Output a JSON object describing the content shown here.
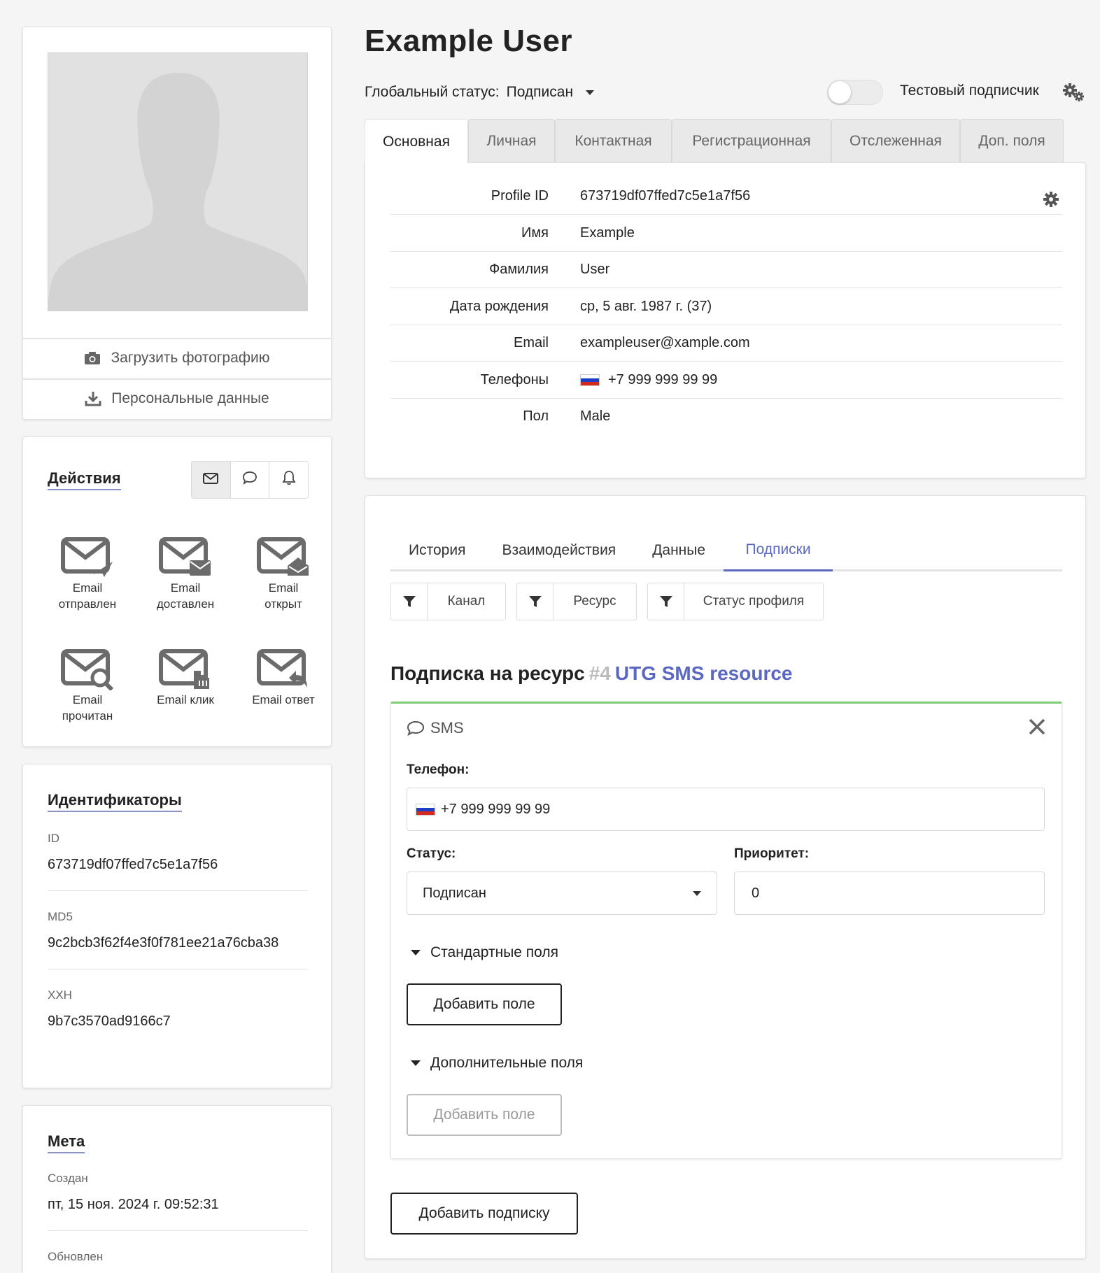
{
  "profile": {
    "name": "Example User",
    "upload_photo_label": "Загрузить фотографию",
    "personal_data_label": "Персональные данные"
  },
  "actions": {
    "title": "Действия",
    "items": [
      {
        "label": "Email\nотправлен",
        "l1": "Email",
        "l2": "отправлен",
        "icon": "email-sent-icon"
      },
      {
        "label": "Email доставлен",
        "l1": "Email",
        "l2": "доставлен",
        "icon": "email-delivered-icon"
      },
      {
        "label": "Email открыт",
        "l1": "Email",
        "l2": "открыт",
        "icon": "email-opened-icon"
      },
      {
        "label": "Email прочитан",
        "l1": "Email",
        "l2": "прочитан",
        "icon": "email-read-icon"
      },
      {
        "label": "Email клик",
        "l1": "Email клик",
        "l2": "",
        "icon": "email-click-icon"
      },
      {
        "label": "Email ответ",
        "l1": "Email ответ",
        "l2": "",
        "icon": "email-reply-icon"
      }
    ]
  },
  "identifiers": {
    "title": "Идентификаторы",
    "id_label": "ID",
    "id_value": "673719df07ffed7c5e1a7f56",
    "md5_label": "MD5",
    "md5_value": "9c2bcb3f62f4e3f0f781ee21a76cba38",
    "xxh_label": "XXH",
    "xxh_value": "9b7c3570ad9166c7"
  },
  "meta": {
    "title": "Мета",
    "created_label": "Создан",
    "created_value": "пт, 15 ноя. 2024 г. 09:52:31",
    "updated_label": "Обновлен"
  },
  "header": {
    "global_status_label": "Глобальный статус:",
    "global_status_value": "Подписан",
    "test_subscriber_label": "Тестовый подписчик"
  },
  "tabs": [
    "Основная",
    "Личная",
    "Контактная",
    "Регистрационная",
    "Отслеженная",
    "Доп. поля"
  ],
  "profile_fields": [
    {
      "label": "Profile ID",
      "value": "673719df07ffed7c5e1a7f56"
    },
    {
      "label": "Имя",
      "value": "Example"
    },
    {
      "label": "Фамилия",
      "value": "User"
    },
    {
      "label": "Дата рождения",
      "value": "ср, 5 авг. 1987 г. (37)"
    },
    {
      "label": "Email",
      "value": "exampleuser@xample.com"
    },
    {
      "label": "Телефоны",
      "value": "+7 999 999 99 99"
    },
    {
      "label": "Пол",
      "value": "Male"
    }
  ],
  "inner_tabs": [
    "История",
    "Взаимодействия",
    "Данные",
    "Подписки"
  ],
  "filters": [
    "Канал",
    "Ресурс",
    "Статус профиля"
  ],
  "subscription": {
    "heading": "Подписка на ресурс",
    "resource_number": "#4",
    "resource_name": "UTG SMS resource",
    "channel": "SMS",
    "phone_label": "Телефон:",
    "phone_value": "+7 999 999 99 99",
    "status_label": "Статус:",
    "status_value": "Подписан",
    "priority_label": "Приоритет:",
    "priority_value": "0",
    "standard_fields_label": "Стандартные поля",
    "add_field_label": "Добавить поле",
    "extra_fields_label": "Дополнительные поля",
    "add_field_disabled_label": "Добавить поле",
    "add_subscription_label": "Добавить подписку"
  },
  "colors": {
    "accent": "#5a68c4",
    "success_border": "#7ccd76"
  }
}
